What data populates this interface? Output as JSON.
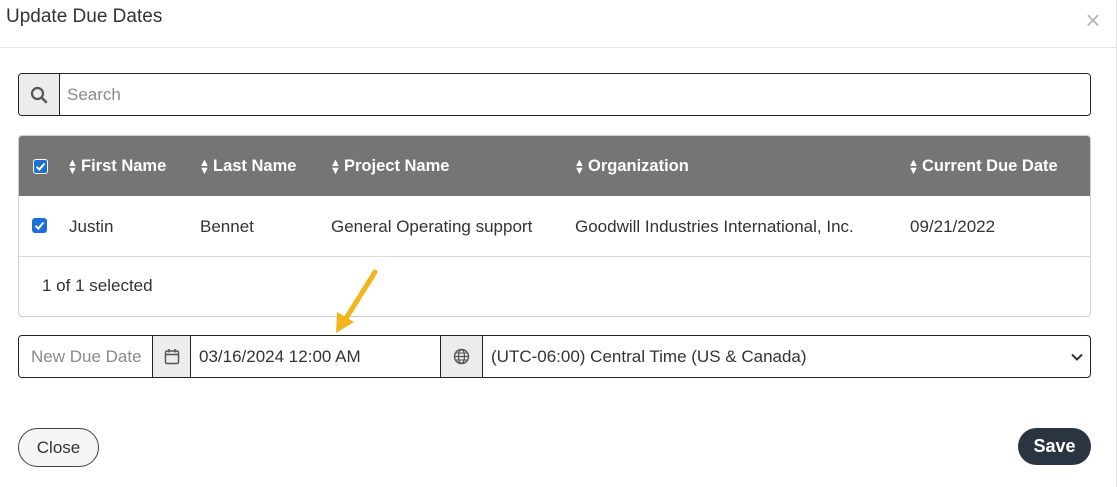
{
  "dialog": {
    "title": "Update Due Dates",
    "close_symbol": "×"
  },
  "search": {
    "placeholder": "Search",
    "value": "",
    "icon": "search-icon"
  },
  "table": {
    "columns": [
      "First Name",
      "Last Name",
      "Project Name",
      "Organization",
      "Current Due Date"
    ],
    "rows": [
      {
        "selected": true,
        "first_name": "Justin",
        "last_name": "Bennet",
        "project_name": "General Operating support",
        "organization": "Goodwill Industries International, Inc.",
        "current_due_date": "09/21/2022"
      }
    ],
    "select_all": true,
    "selection_summary": "1 of 1 selected"
  },
  "due_date": {
    "label": "New Due Date",
    "value": "03/16/2024 12:00 AM",
    "calendar_icon": "calendar-icon",
    "globe_icon": "globe-icon",
    "timezone": "(UTC-06:00) Central Time (US & Canada)"
  },
  "buttons": {
    "close": "Close",
    "save": "Save"
  },
  "colors": {
    "header_bg": "#757575",
    "checkbox": "#1d6fd6",
    "save_bg": "#2b3441",
    "annotation_arrow": "#f2b51d"
  }
}
